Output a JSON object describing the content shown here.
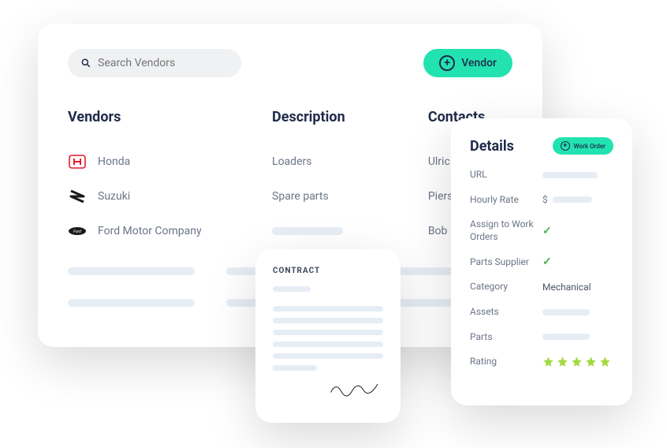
{
  "main": {
    "search_placeholder": "Search Vendors",
    "add_vendor_label": "Vendor",
    "columns": {
      "vendors": "Vendors",
      "description": "Description",
      "contacts": "Contacts"
    },
    "rows": [
      {
        "vendor": "Honda",
        "description": "Loaders",
        "contact": "Ulric Toc"
      },
      {
        "vendor": "Suzuki",
        "description": "Spare parts",
        "contact": "Piers Mc"
      },
      {
        "vendor": "Ford Motor Company",
        "description": "",
        "contact": "Bob Dyle"
      }
    ]
  },
  "contract": {
    "title": "CONTRACT"
  },
  "details": {
    "title": "Details",
    "work_order_label": "Work Order",
    "fields": {
      "url": "URL",
      "hourly_rate": "Hourly Rate",
      "hourly_rate_prefix": "$",
      "assign": "Assign to Work Orders",
      "parts_supplier": "Parts Supplier",
      "category": "Category",
      "category_value": "Mechanical",
      "assets": "Assets",
      "parts": "Parts",
      "rating": "Rating"
    },
    "rating": 5
  }
}
